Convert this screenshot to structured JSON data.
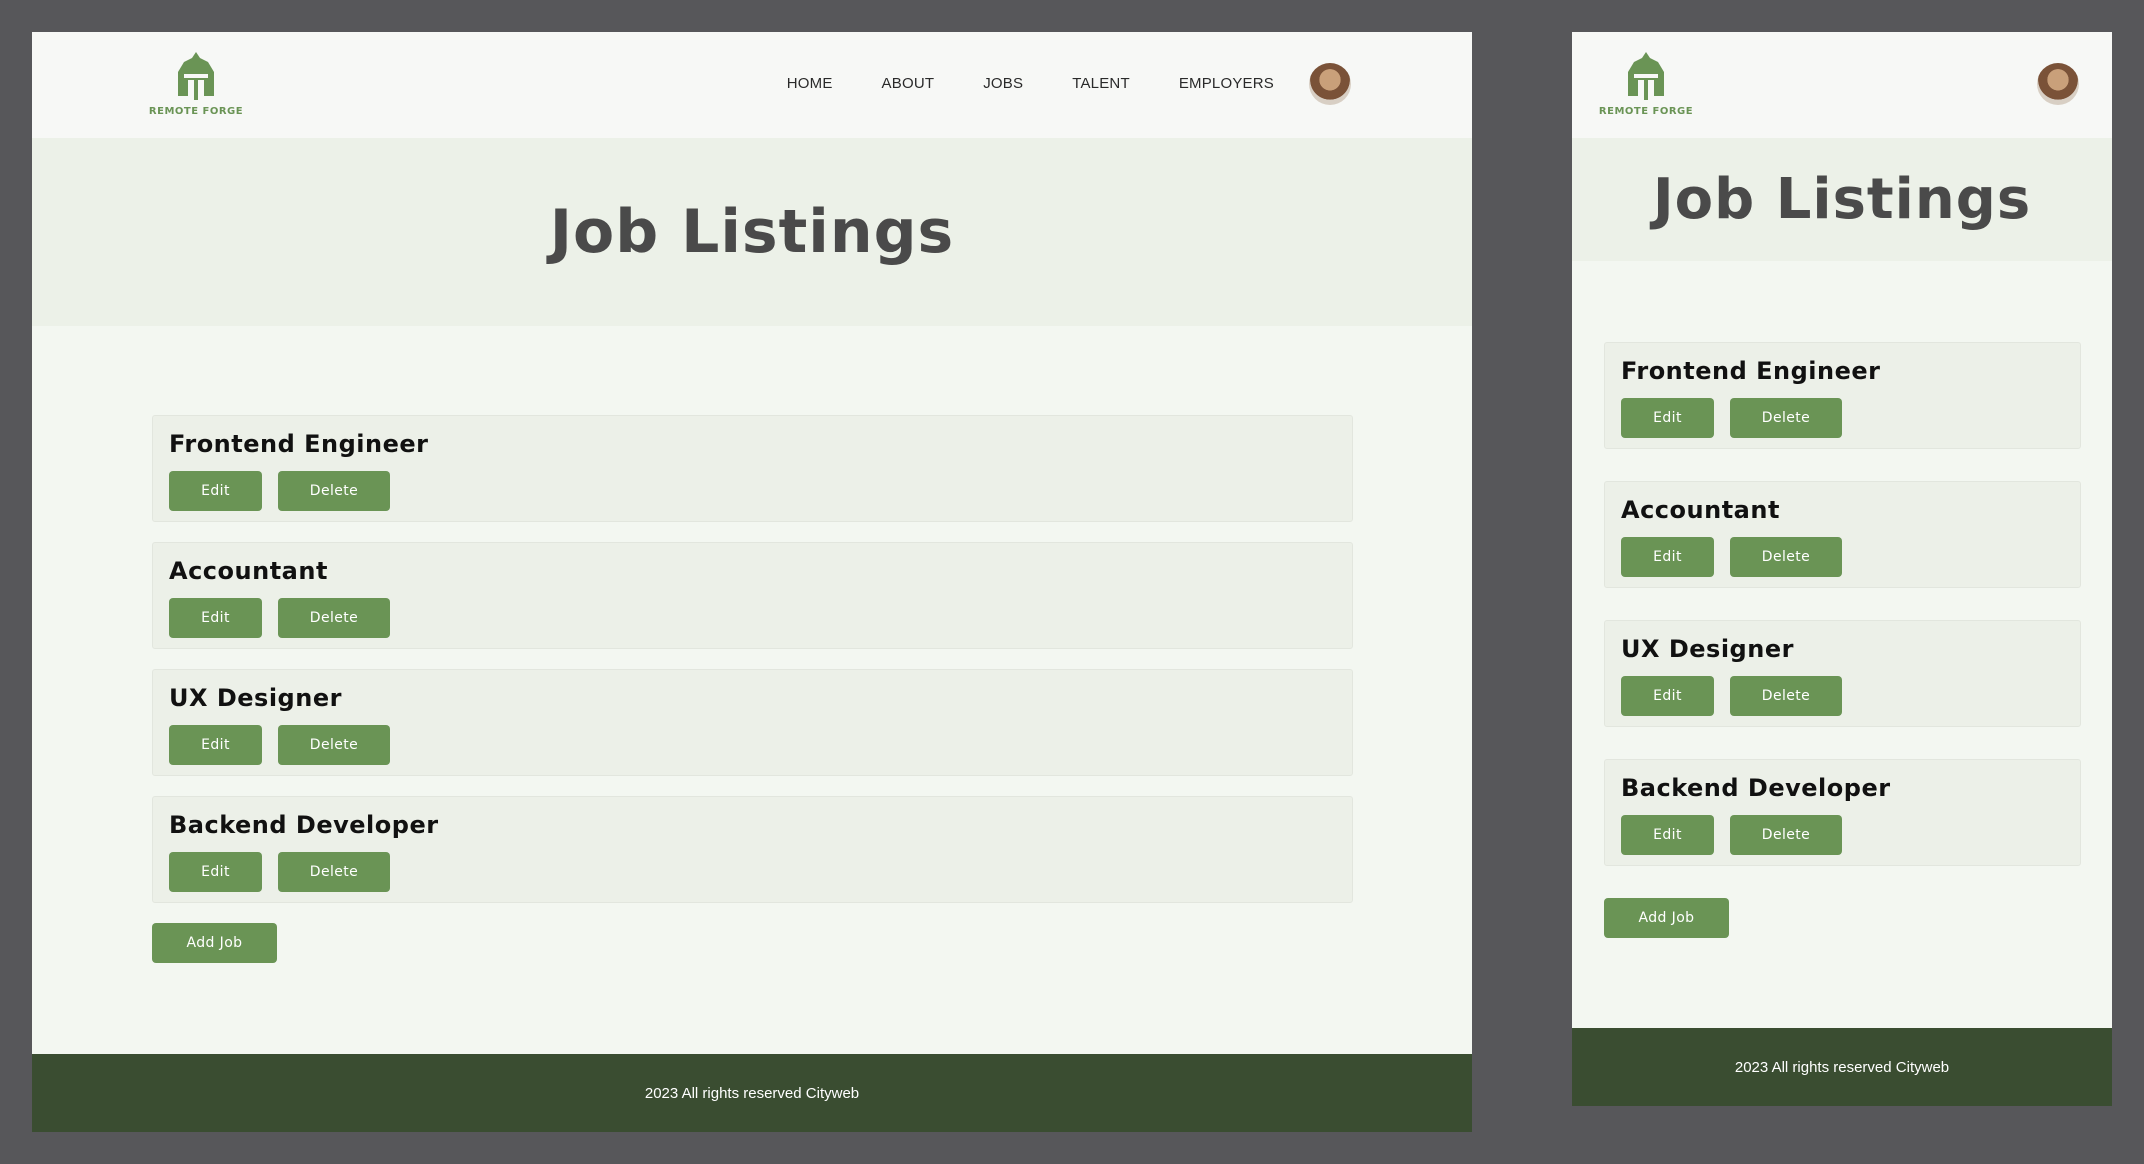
{
  "brand": {
    "name": "REMOTE FORGE"
  },
  "nav": {
    "items": [
      "HOME",
      "ABOUT",
      "JOBS",
      "TALENT",
      "EMPLOYERS"
    ]
  },
  "page": {
    "title": "Job Listings"
  },
  "jobs": [
    {
      "title": "Frontend Engineer"
    },
    {
      "title": "Accountant"
    },
    {
      "title": "UX Designer"
    },
    {
      "title": "Backend Developer"
    }
  ],
  "actions": {
    "edit_label": "Edit",
    "delete_label": "Delete",
    "add_label": "Add Job"
  },
  "footer": {
    "text": "2023 All rights reserved Cityweb"
  },
  "colors": {
    "accent": "#6a9455",
    "footer_bg": "#3a4d31",
    "hero_bg": "#ecf1e8",
    "page_bg": "#f3f7f1"
  },
  "icons": {
    "logo": "knight-helmet-icon",
    "avatar": "user-avatar"
  }
}
